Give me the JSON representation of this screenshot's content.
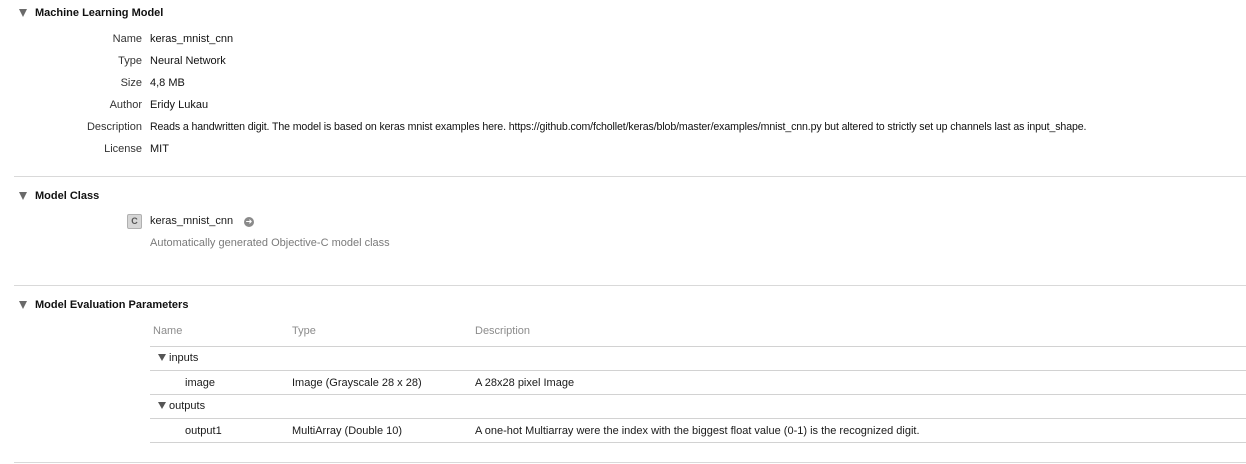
{
  "sections": {
    "ml_model": {
      "title": "Machine Learning Model",
      "properties": [
        {
          "label": "Name",
          "value": "keras_mnist_cnn"
        },
        {
          "label": "Type",
          "value": "Neural Network"
        },
        {
          "label": "Size",
          "value": "4,8 MB"
        },
        {
          "label": "Author",
          "value": "Eridy Lukau"
        },
        {
          "label": "Description",
          "value": "Reads a handwritten digit. The model is based on keras mnist examples here. https://github.com/fchollet/keras/blob/master/examples/mnist_cnn.py but altered to strictly set up channels last as input_shape."
        },
        {
          "label": "License",
          "value": "MIT"
        }
      ]
    },
    "model_class": {
      "title": "Model Class",
      "badge": "C",
      "class_name": "keras_mnist_cnn",
      "description": "Automatically generated Objective-C model class",
      "goto_icon": "goto-arrow-icon"
    },
    "evaluation": {
      "title": "Model Evaluation Parameters",
      "columns": [
        "Name",
        "Type",
        "Description"
      ],
      "groups": [
        {
          "label": "inputs",
          "rows": [
            {
              "name": "image",
              "type": "Image (Grayscale 28 x 28)",
              "description": "A 28x28 pixel Image"
            }
          ]
        },
        {
          "label": "outputs",
          "rows": [
            {
              "name": "output1",
              "type": "MultiArray (Double 10)",
              "description": "A one-hot Multiarray were the index with the biggest float value (0-1) is the recognized digit."
            }
          ]
        }
      ]
    }
  }
}
